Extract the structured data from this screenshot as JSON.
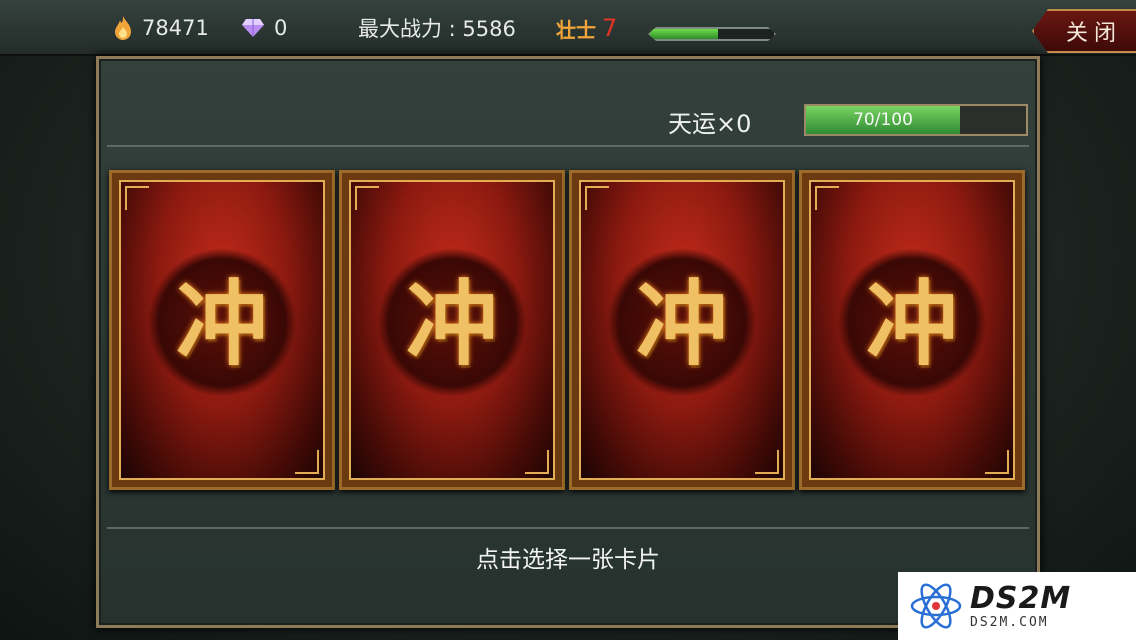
{
  "topbar": {
    "gold": "78471",
    "gems": "0",
    "power": "最大战力 : 5586",
    "rank_title": "壮士",
    "rank_level": "7",
    "rank_progress": 0.55,
    "close_label": "关闭"
  },
  "luck": {
    "label": "天运×0",
    "bar_text": "70/100",
    "progress": 0.7
  },
  "cards": [
    {
      "glyph": "冲"
    },
    {
      "glyph": "冲"
    },
    {
      "glyph": "冲"
    },
    {
      "glyph": "冲"
    }
  ],
  "prompt": "点击选择一张卡片",
  "watermark": {
    "title": "DS2M",
    "url": "DS2M.COM"
  },
  "colors": {
    "gold_icon": "#f0a43a",
    "gem_icon": "#b88cf0",
    "rank_level": "#e53323",
    "bar_fill": "#3fa33a"
  }
}
